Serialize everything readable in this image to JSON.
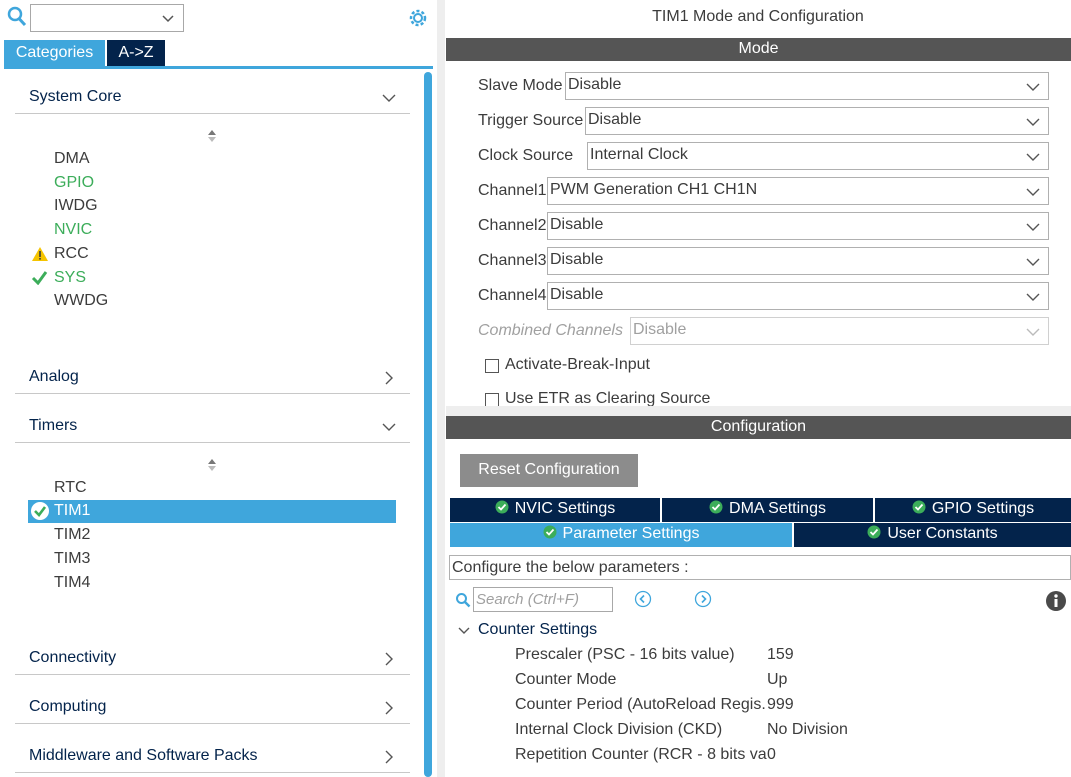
{
  "left": {
    "search": {
      "value": ""
    },
    "tabs": [
      {
        "label": "Categories"
      },
      {
        "label": "A->Z"
      }
    ],
    "categories": {
      "system_core": {
        "label": "System Core",
        "items": [
          {
            "label": "DMA",
            "status": "none"
          },
          {
            "label": "GPIO",
            "status": "configured"
          },
          {
            "label": "IWDG",
            "status": "none"
          },
          {
            "label": "NVIC",
            "status": "configured"
          },
          {
            "label": "RCC",
            "status": "warning"
          },
          {
            "label": "SYS",
            "status": "ok"
          },
          {
            "label": "WWDG",
            "status": "none"
          }
        ]
      },
      "analog": {
        "label": "Analog"
      },
      "timers": {
        "label": "Timers",
        "items": [
          {
            "label": "RTC",
            "status": "none"
          },
          {
            "label": "TIM1",
            "status": "selected-ok"
          },
          {
            "label": "TIM2",
            "status": "none"
          },
          {
            "label": "TIM3",
            "status": "none"
          },
          {
            "label": "TIM4",
            "status": "none"
          }
        ]
      },
      "connectivity": {
        "label": "Connectivity"
      },
      "computing": {
        "label": "Computing"
      },
      "middleware": {
        "label": "Middleware and Software Packs"
      }
    }
  },
  "right": {
    "title": "TIM1 Mode and Configuration",
    "mode_bar": "Mode",
    "mode_fields": [
      {
        "label": "Slave Mode",
        "value": "Disable",
        "enabled": true
      },
      {
        "label": "Trigger Source",
        "value": "Disable",
        "enabled": true
      },
      {
        "label": "Clock Source",
        "value": "Internal Clock",
        "enabled": true
      },
      {
        "label": "Channel1",
        "value": "PWM Generation CH1 CH1N",
        "enabled": true
      },
      {
        "label": "Channel2",
        "value": "Disable",
        "enabled": true
      },
      {
        "label": "Channel3",
        "value": "Disable",
        "enabled": true
      },
      {
        "label": "Channel4",
        "value": "Disable",
        "enabled": true
      },
      {
        "label": "Combined Channels",
        "value": "Disable",
        "enabled": false
      }
    ],
    "checkboxes": [
      {
        "label": "Activate-Break-Input",
        "checked": false
      },
      {
        "label": "Use ETR as Clearing Source",
        "checked": false
      }
    ],
    "config_bar": "Configuration",
    "reset_label": "Reset Configuration",
    "config_tabs_row1": [
      "NVIC Settings",
      "DMA Settings",
      "GPIO Settings"
    ],
    "config_tabs_row2": [
      "Parameter Settings",
      "User Constants"
    ],
    "config_desc": "Configure the below parameters :",
    "param_search_placeholder": "Search (Ctrl+F)",
    "group": "Counter Settings",
    "params": [
      {
        "label": "Prescaler (PSC - 16 bits value)",
        "value": "159"
      },
      {
        "label": "Counter Mode",
        "value": "Up"
      },
      {
        "label": "Counter Period (AutoReload Regis...",
        "value": "999"
      },
      {
        "label": "Internal Clock Division (CKD)",
        "value": "No Division"
      },
      {
        "label": "Repetition Counter (RCR - 8 bits va...",
        "value": "0"
      }
    ]
  },
  "colors": {
    "accent": "#3fa6dc",
    "navy": "#03234b",
    "bar": "#555555",
    "green": "#3cad5a",
    "warning": "#f5c400"
  }
}
